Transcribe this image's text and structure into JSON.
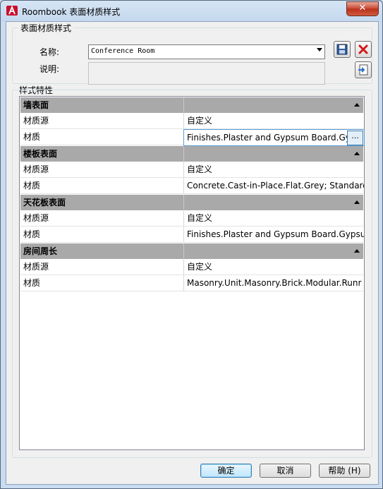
{
  "window": {
    "title": "Roombook 表面材质样式",
    "close_label": "✕"
  },
  "style_group": {
    "label": "表面材质样式",
    "name_label": "名称:",
    "name_value": "Conference Room",
    "desc_label": "说明:",
    "desc_value": ""
  },
  "icons": {
    "save": "save-icon",
    "delete": "delete-icon",
    "import": "import-icon"
  },
  "props_group": {
    "label": "样式特性",
    "categories": [
      {
        "name": "墙表面",
        "rows": [
          {
            "k": "材质源",
            "v": "自定义"
          },
          {
            "k": "材质",
            "v": "Finishes.Plaster and Gypsum Board.Gyp"
          }
        ]
      },
      {
        "name": "楼板表面",
        "rows": [
          {
            "k": "材质源",
            "v": "自定义"
          },
          {
            "k": "材质",
            "v": "Concrete.Cast-in-Place.Flat.Grey; Standard"
          }
        ]
      },
      {
        "name": "天花板表面",
        "rows": [
          {
            "k": "材质源",
            "v": "自定义"
          },
          {
            "k": "材质",
            "v": "Finishes.Plaster and Gypsum Board.Gypsur"
          }
        ]
      },
      {
        "name": "房间周长",
        "rows": [
          {
            "k": "材质源",
            "v": "自定义"
          },
          {
            "k": "材质",
            "v": "Masonry.Unit.Masonry.Brick.Modular.Runr"
          }
        ]
      }
    ],
    "browse_label": "..."
  },
  "buttons": {
    "ok": "确定",
    "cancel": "取消",
    "help": "帮助 (H)"
  }
}
